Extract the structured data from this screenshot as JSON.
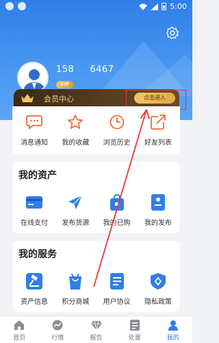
{
  "status_bar": {
    "time": "5:00"
  },
  "profile": {
    "phone": "158     6467",
    "vip_badge": "VIP"
  },
  "member": {
    "title": "会员中心",
    "enter_label": "点击进入"
  },
  "quick_actions": [
    {
      "label": "消息通知",
      "icon": "message-icon"
    },
    {
      "label": "我的收藏",
      "icon": "star-icon"
    },
    {
      "label": "浏览历史",
      "icon": "clock-icon"
    },
    {
      "label": "好友列表",
      "icon": "share-icon"
    }
  ],
  "assets": {
    "title": "我的资产",
    "items": [
      {
        "label": "在线支付",
        "icon": "card-icon"
      },
      {
        "label": "发布货源",
        "icon": "send-icon"
      },
      {
        "label": "我的已购",
        "icon": "shopping-bag-icon"
      },
      {
        "label": "我的发布",
        "icon": "id-card-icon"
      }
    ]
  },
  "services": {
    "title": "我的服务",
    "items": [
      {
        "label": "资产信息",
        "icon": "gavel-icon"
      },
      {
        "label": "积分商城",
        "icon": "bag-icon"
      },
      {
        "label": "用户协议",
        "icon": "document-icon"
      },
      {
        "label": "隐私政策",
        "icon": "shield-icon"
      }
    ]
  },
  "tabbar": [
    {
      "label": "首页",
      "icon": "home-icon"
    },
    {
      "label": "行情",
      "icon": "chart-icon"
    },
    {
      "label": "报告",
      "icon": "diamond-icon"
    },
    {
      "label": "处置",
      "icon": "list-icon"
    },
    {
      "label": "我的",
      "icon": "user-icon",
      "active": true
    }
  ],
  "colors": {
    "primary": "#2f7fe8",
    "accent_orange": "#f06a3c",
    "gold": "#f2c463",
    "annotation_red": "#e53935"
  }
}
